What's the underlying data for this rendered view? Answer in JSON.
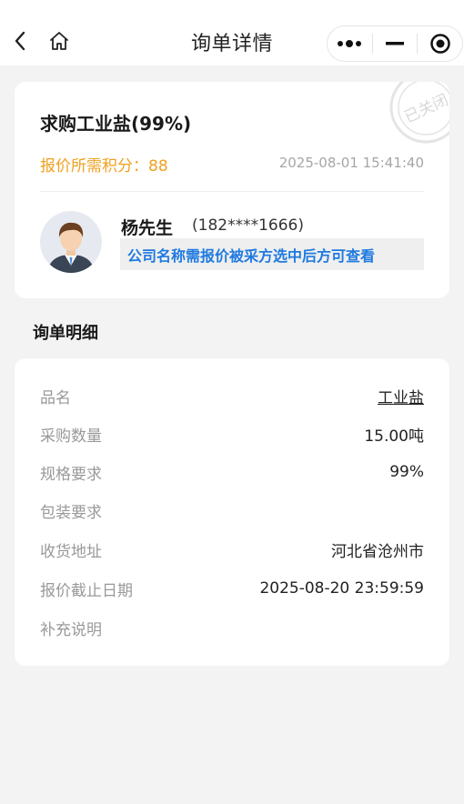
{
  "nav": {
    "title": "询单详情"
  },
  "inquiry": {
    "title": "求购工业盐(99%)",
    "points_label": "报价所需积分：",
    "points_value": "88",
    "timestamp": "2025-08-01 15:41:40",
    "stamp_text": "已关闭",
    "contact_name": "杨先生",
    "contact_phone": "(182****1666)",
    "company_notice": "公司名称需报价被采方选中后方可查看"
  },
  "detail": {
    "heading": "询单明细",
    "rows": [
      {
        "label": "品名",
        "value": "工业盐"
      },
      {
        "label": "采购数量",
        "value": "15.00吨"
      },
      {
        "label": "规格要求",
        "value": "99%"
      },
      {
        "label": "包装要求",
        "value": ""
      },
      {
        "label": "收货地址",
        "value": "河北省沧州市"
      },
      {
        "label": "报价截止日期",
        "value": "2025-08-20 23:59:59"
      },
      {
        "label": "补充说明",
        "value": ""
      }
    ]
  },
  "colors": {
    "accent_orange": "#f0a020",
    "link_blue": "#1f7ae0",
    "background": "#f3f3f3"
  },
  "icons": [
    "back-arrow-icon",
    "home-icon",
    "more-dots-icon",
    "minimize-icon",
    "close-target-icon",
    "avatar-icon",
    "closed-stamp-icon"
  ]
}
